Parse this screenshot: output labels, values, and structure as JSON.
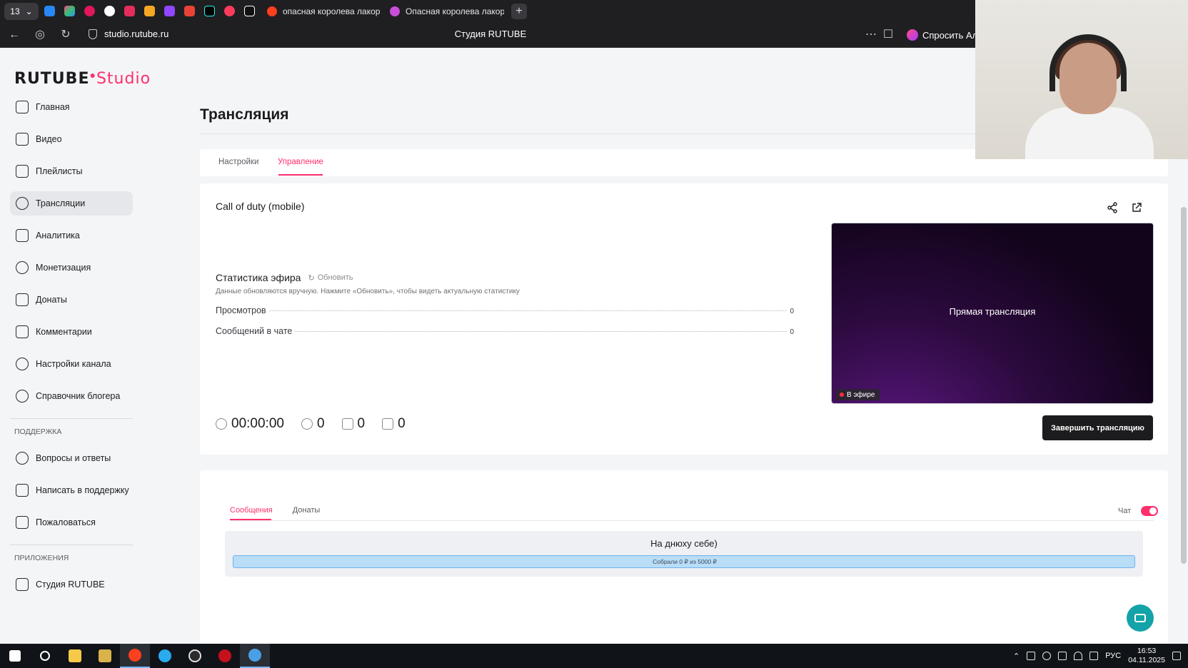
{
  "browser": {
    "tab_count": "13",
    "tabs": [
      {
        "title": "опасная королева лакор"
      },
      {
        "title": "Опасная королева лакор"
      }
    ],
    "url": "studio.rutube.ru",
    "page_title": "Студия RUTUBE",
    "ask_label": "Спросить Ал"
  },
  "logo": {
    "brand": "RUTUBE",
    "product": "Studio"
  },
  "sidebar": {
    "items": [
      {
        "label": "Главная",
        "icon": "home-icon"
      },
      {
        "label": "Видео",
        "icon": "video-icon"
      },
      {
        "label": "Плейлисты",
        "icon": "playlist-icon"
      },
      {
        "label": "Трансляции",
        "icon": "broadcast-icon"
      },
      {
        "label": "Аналитика",
        "icon": "analytics-icon"
      },
      {
        "label": "Монетизация",
        "icon": "coin-icon"
      },
      {
        "label": "Донаты",
        "icon": "donate-icon"
      },
      {
        "label": "Комментарии",
        "icon": "comment-icon"
      },
      {
        "label": "Настройки канала",
        "icon": "gear-icon"
      },
      {
        "label": "Справочник блогера",
        "icon": "info-icon"
      }
    ],
    "support_title": "ПОДДЕРЖКА",
    "support_items": [
      {
        "label": "Вопросы и ответы",
        "icon": "question-icon"
      },
      {
        "label": "Написать в поддержку",
        "icon": "mail-icon"
      },
      {
        "label": "Пожаловаться",
        "icon": "flag-icon"
      }
    ],
    "apps_title": "ПРИЛОЖЕНИЯ",
    "apps_items": [
      {
        "label": "Студия RUTUBE",
        "icon": "studio-icon"
      }
    ]
  },
  "main": {
    "heading": "Трансляция",
    "tabs": [
      {
        "label": "Настройки"
      },
      {
        "label": "Управление",
        "active": true
      }
    ],
    "stream_title": "Call of duty (mobile)",
    "stats_title": "Статистика эфира",
    "refresh_label": "Обновить",
    "stats_note": "Данные обновляются вручную. Нажмите «Обновить», чтобы видеть актуальную статистику",
    "stats": [
      {
        "label": "Просмотров",
        "value": "0"
      },
      {
        "label": "Сообщений в чате",
        "value": "0"
      }
    ],
    "timer": "00:00:00",
    "viewers": "0",
    "likes": "0",
    "dislikes": "0",
    "preview_label": "Прямая трансляция",
    "live_badge": "В эфире",
    "end_button": "Завершить трансляцию"
  },
  "chat": {
    "tabs": [
      {
        "label": "Сообщения",
        "active": true
      },
      {
        "label": "Донаты"
      }
    ],
    "toggle_label": "Чат",
    "toggle_on": true,
    "goal_title": "На днюху себе)",
    "goal_text": "Собрали 0 ₽ из 5000 ₽",
    "goal_progress": 0
  },
  "taskbar": {
    "lang": "РУС",
    "time": "16:53",
    "date": "04.11.2025"
  },
  "colors": {
    "accent": "#ff2f6d",
    "dark_button": "#1c1c1e",
    "progress": "#4aa5ea",
    "help_fab": "#14a3a8"
  }
}
